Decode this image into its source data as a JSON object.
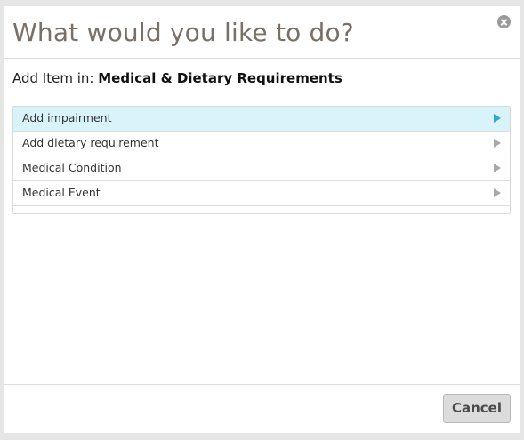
{
  "dialog": {
    "title": "What would you like to do?",
    "close_icon": "close-circle-icon"
  },
  "context": {
    "prefix": "Add Item in:",
    "name": "Medical & Dietary Requirements"
  },
  "options": [
    {
      "label": "Add impairment",
      "selected": true,
      "icon": "chevron-right-icon"
    },
    {
      "label": "Add dietary requirement",
      "selected": false,
      "icon": "chevron-right-icon"
    },
    {
      "label": "Medical Condition",
      "selected": false,
      "icon": "chevron-right-icon"
    },
    {
      "label": "Medical Event",
      "selected": false,
      "icon": "chevron-right-icon"
    }
  ],
  "footer": {
    "cancel_label": "Cancel"
  },
  "colors": {
    "selected_row": "#d8f3f9",
    "selected_arrow": "#35a9c9",
    "title": "#7a7066"
  }
}
